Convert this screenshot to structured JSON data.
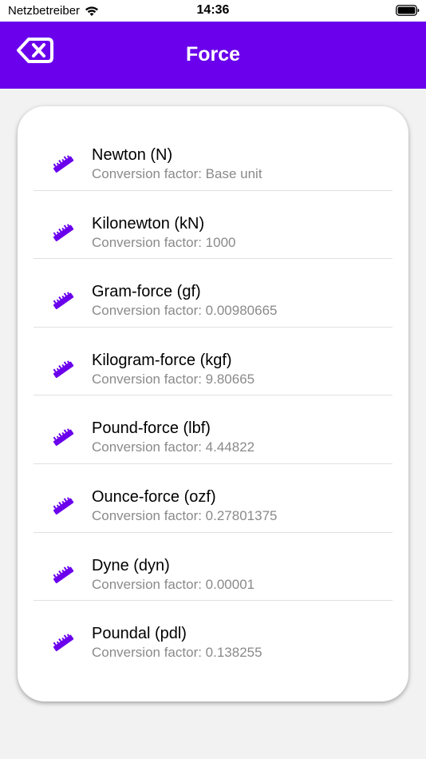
{
  "status_bar": {
    "carrier": "Netzbetreiber",
    "time": "14:36"
  },
  "header": {
    "title": "Force",
    "back_icon": "backspace-icon"
  },
  "colors": {
    "accent": "#6a00ec",
    "background": "#f2f2f2",
    "secondary_text": "#8a8a8a"
  },
  "units": [
    {
      "name": "Newton (N)",
      "factor": "Conversion factor: Base unit",
      "icon": "ruler-icon"
    },
    {
      "name": "Kilonewton (kN)",
      "factor": "Conversion factor: 1000",
      "icon": "ruler-icon"
    },
    {
      "name": "Gram-force (gf)",
      "factor": "Conversion factor: 0.00980665",
      "icon": "ruler-icon"
    },
    {
      "name": "Kilogram-force (kgf)",
      "factor": "Conversion factor: 9.80665",
      "icon": "ruler-icon"
    },
    {
      "name": "Pound-force (lbf)",
      "factor": "Conversion factor: 4.44822",
      "icon": "ruler-icon"
    },
    {
      "name": "Ounce-force (ozf)",
      "factor": "Conversion factor: 0.27801375",
      "icon": "ruler-icon"
    },
    {
      "name": "Dyne (dyn)",
      "factor": "Conversion factor: 0.00001",
      "icon": "ruler-icon"
    },
    {
      "name": "Poundal (pdl)",
      "factor": "Conversion factor: 0.138255",
      "icon": "ruler-icon"
    }
  ]
}
